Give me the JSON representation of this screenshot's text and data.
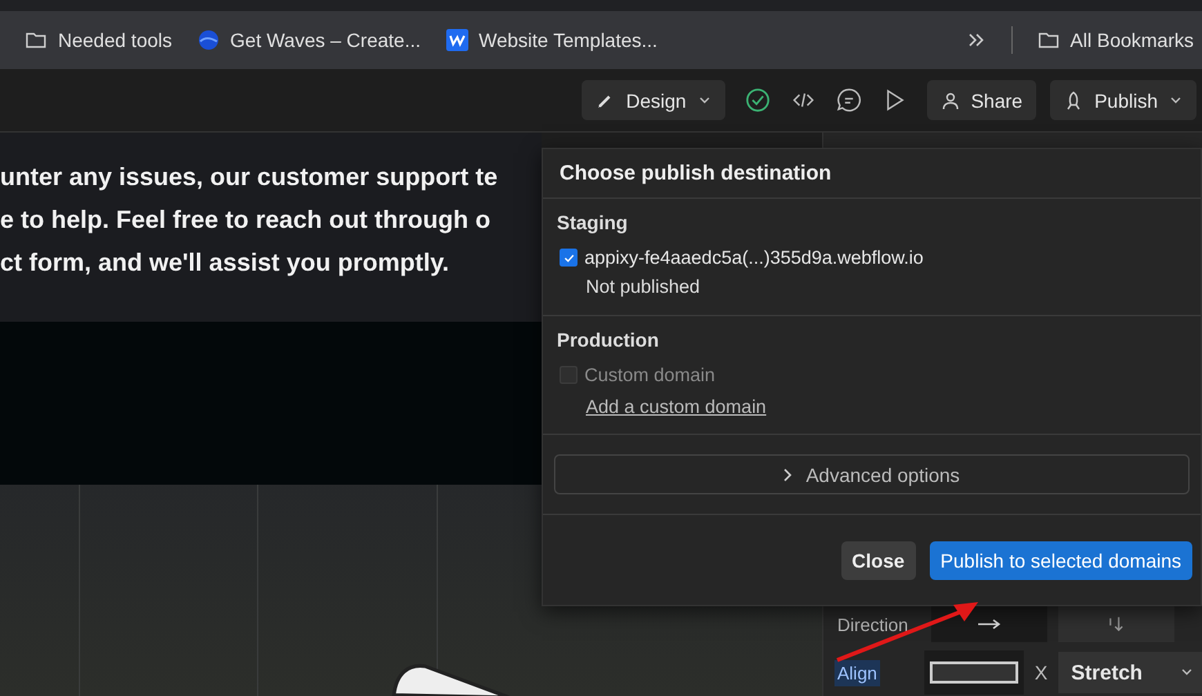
{
  "bookmarks_bar": {
    "items": [
      {
        "kind": "folder",
        "label": "Needed tools"
      },
      {
        "kind": "waves",
        "label": "Get Waves – Create..."
      },
      {
        "kind": "webflow",
        "label": "Website Templates..."
      }
    ],
    "all_bookmarks": "All Bookmarks"
  },
  "toolbar": {
    "mode": "Design",
    "share": "Share",
    "publish": "Publish"
  },
  "canvas": {
    "text_lines": [
      "unter any issues, our customer support te",
      "e to help. Feel free to reach out through o",
      "ct form, and we'll assist you promptly."
    ]
  },
  "publish_popover": {
    "title": "Choose publish destination",
    "sections": [
      {
        "heading": "Staging",
        "options": [
          {
            "label": "appixy-fe4aaedc5a(...)355d9a.webflow.io",
            "checked": true,
            "disabled": false,
            "note": "Not published"
          }
        ]
      },
      {
        "heading": "Production",
        "options": [
          {
            "label": "Custom domain",
            "checked": false,
            "disabled": true,
            "link": "Add a custom domain"
          }
        ]
      }
    ],
    "advanced": "Advanced options",
    "close_button": "Close",
    "publish_button": "Publish to selected domains"
  },
  "style_panel": {
    "direction_label": "Direction",
    "align_label": "Align",
    "align_highlighted": true,
    "x_label": "X",
    "align_select": "Stretch"
  }
}
